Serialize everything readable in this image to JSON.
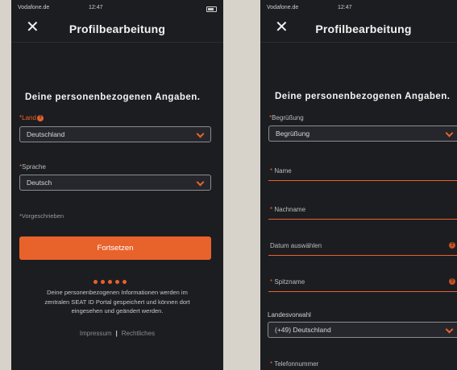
{
  "status_bar": {
    "carrier": "Vodafone.de",
    "time": "12:47"
  },
  "header": {
    "title": "Profilbearbeitung"
  },
  "left": {
    "heading": "Deine personenbezogenen Angaben.",
    "country": {
      "label": "Land",
      "value": "Deutschland"
    },
    "language": {
      "label": "Sprache",
      "value": "Deutsch"
    },
    "required_note": "*Vorgeschrieben",
    "continue_label": "Fortsetzen",
    "pager": {
      "pages": 5,
      "current": 1
    },
    "info_lines": [
      "Deine personenbezogenen Informationen werden im",
      "zentralen SEAT ID Portal gespeichert und können dort",
      "eingesehen und geändert werden."
    ],
    "footer": {
      "imprint": "Impressum",
      "legal": "Rechtliches",
      "separator": "|"
    }
  },
  "right": {
    "heading": "Deine personenbezogenen Angaben.",
    "salutation": {
      "label": "Begrüßung",
      "value": "Begrüßung"
    },
    "fields": {
      "name": "Name",
      "surname": "Nachname",
      "date": "Datum auswählen",
      "nickname": "Spitzname",
      "phone": "Telefonnummer"
    },
    "dial_code": {
      "label": "Landesvorwahl",
      "value": "(+49) Deutschland"
    }
  },
  "colors": {
    "accent": "#e8622c",
    "background": "#1c1d21",
    "frame": "#d8d3ca"
  }
}
